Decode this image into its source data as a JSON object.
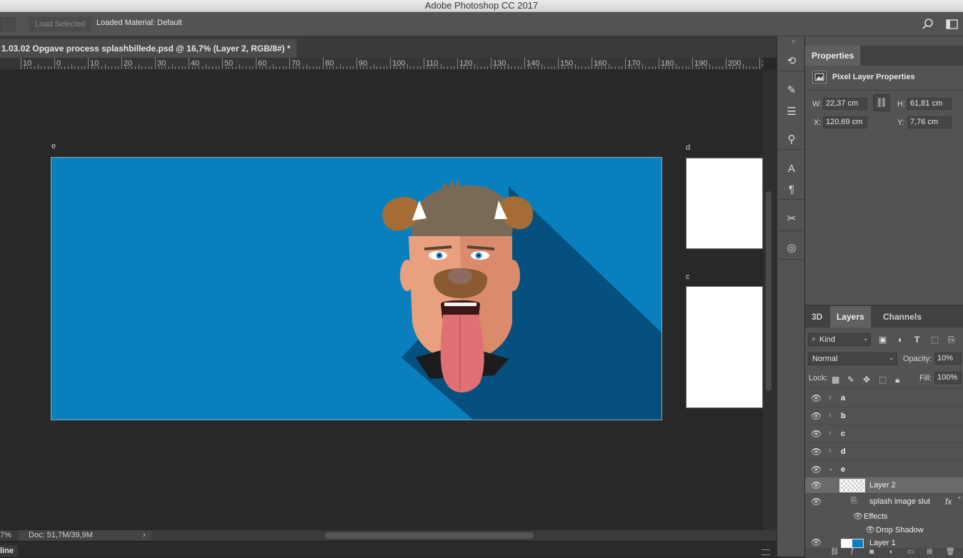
{
  "app": {
    "title": "Adobe Photoshop CC 2017"
  },
  "options": {
    "load_selected": "Load Selected",
    "loaded_material": "Loaded Material: Default"
  },
  "document": {
    "tab_title": "1.03.02 Opgave process splashbillede.psd @ 16,7% (Layer 2, RGB/8#) *"
  },
  "ruler": {
    "labels": [
      "10",
      "0",
      "10",
      "20",
      "30",
      "40",
      "50",
      "60",
      "70",
      "80",
      "90",
      "100",
      "110",
      "120",
      "130",
      "140",
      "150",
      "160",
      "170",
      "180",
      "190",
      "200",
      "2"
    ]
  },
  "artboards": {
    "e": "e",
    "d": "d",
    "c": "c"
  },
  "status": {
    "zoom": "7%",
    "doc": "Doc: 51,7M/39,9M",
    "arrow": "›"
  },
  "bottom": {
    "timeline": "line"
  },
  "properties": {
    "tab": "Properties",
    "header": "Pixel Layer Properties",
    "w_label": "W:",
    "w_value": "22,37 cm",
    "h_label": "H:",
    "h_value": "61,81 cm",
    "x_label": "X:",
    "x_value": "120,69 cm",
    "y_label": "Y:",
    "y_value": "7,76 cm"
  },
  "layers_panel": {
    "tabs": [
      "3D",
      "Layers",
      "Channels"
    ],
    "kind": "Kind",
    "blend_mode": "Normal",
    "opacity_label": "Opacity:",
    "opacity_value": "10%",
    "lock_label": "Lock:",
    "fill_label": "Fill:",
    "fill_value": "100%",
    "groups": [
      "a",
      "b",
      "c",
      "d",
      "e"
    ],
    "layer2": "Layer 2",
    "smart": "splash image slut",
    "effects": "Effects",
    "drop_shadow": "Drop Shadow",
    "layer1": "Layer 1",
    "fx": "fx"
  },
  "colors": {
    "artboard_bg": "#0a7fbd",
    "shadow": "#05507e",
    "panel": "#535353"
  }
}
